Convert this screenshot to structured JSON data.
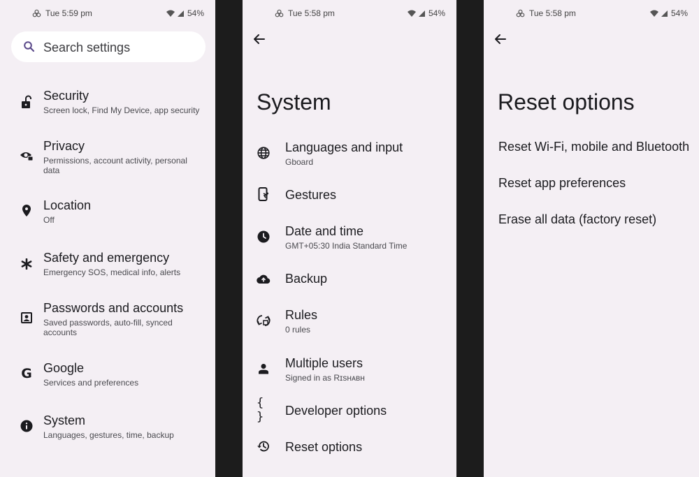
{
  "screens": {
    "settings": {
      "status": {
        "time": "Tue 5:59 pm",
        "battery": "54%"
      },
      "search_placeholder": "Search settings",
      "items": [
        {
          "title": "Security",
          "subtitle": "Screen lock, Find My Device, app security",
          "icon": "lock-open-icon"
        },
        {
          "title": "Privacy",
          "subtitle": "Permissions, account activity, personal data",
          "icon": "privacy-eye-icon"
        },
        {
          "title": "Location",
          "subtitle": "Off",
          "icon": "location-pin-icon"
        },
        {
          "title": "Safety and emergency",
          "subtitle": "Emergency SOS, medical info, alerts",
          "icon": "asterisk-icon"
        },
        {
          "title": "Passwords and accounts",
          "subtitle": "Saved passwords, auto-fill, synced accounts",
          "icon": "account-box-icon"
        },
        {
          "title": "Google",
          "subtitle": "Services and preferences",
          "icon": "google-g-icon"
        },
        {
          "title": "System",
          "subtitle": "Languages, gestures, time, backup",
          "icon": "info-icon"
        }
      ]
    },
    "system": {
      "status": {
        "time": "Tue 5:58 pm",
        "battery": "54%"
      },
      "title": "System",
      "items": [
        {
          "title": "Languages and input",
          "subtitle": "Gboard",
          "icon": "globe-icon"
        },
        {
          "title": "Gestures",
          "subtitle": "",
          "icon": "phone-gesture-icon"
        },
        {
          "title": "Date and time",
          "subtitle": "GMT+05:30 India Standard Time",
          "icon": "clock-icon"
        },
        {
          "title": "Backup",
          "subtitle": "",
          "icon": "cloud-upload-icon"
        },
        {
          "title": "Rules",
          "subtitle": "0 rules",
          "icon": "rules-icon"
        },
        {
          "title": "Multiple users",
          "subtitle": "Signed in as Rɪsʜᴀʙʜ",
          "icon": "person-icon"
        },
        {
          "title": "Developer options",
          "subtitle": "",
          "icon": "braces-icon"
        },
        {
          "title": "Reset options",
          "subtitle": "",
          "icon": "history-icon"
        }
      ]
    },
    "reset": {
      "status": {
        "time": "Tue 5:58 pm",
        "battery": "54%"
      },
      "title": "Reset options",
      "options": [
        "Reset Wi-Fi, mobile and Bluetooth",
        "Reset app preferences",
        "Erase all data (factory reset)"
      ]
    }
  }
}
